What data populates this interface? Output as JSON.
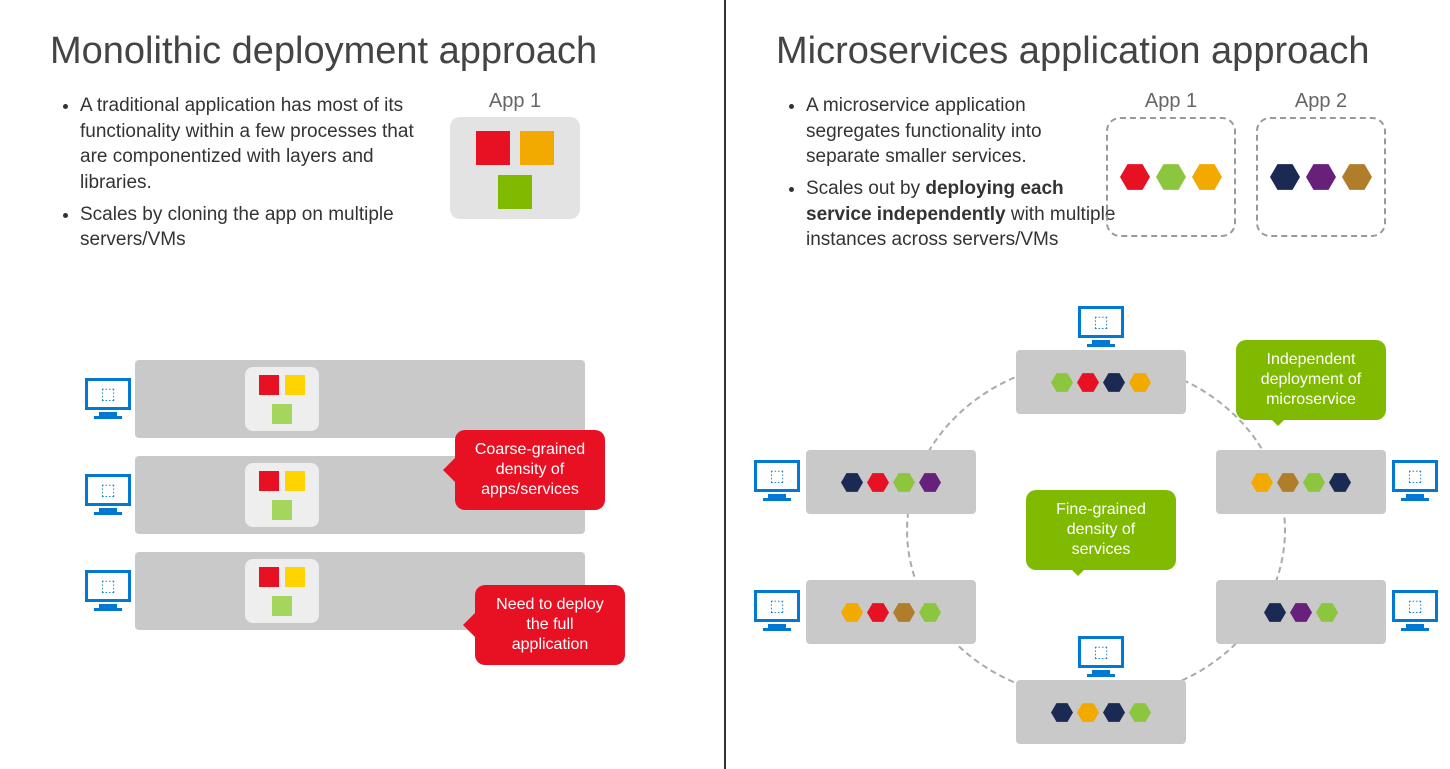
{
  "left": {
    "title": "Monolithic deployment approach",
    "bullets": [
      "A traditional application has most of its functionality within a few processes that are componentized with layers and libraries.",
      "Scales by cloning the app on multiple servers/VMs"
    ],
    "app_label": "App 1",
    "callout1": "Coarse-grained density of apps/services",
    "callout2": "Need to deploy the full application",
    "colors": {
      "red": "#e81123",
      "orange": "#f2a900",
      "green": "#7fba00"
    }
  },
  "right": {
    "title": "Microservices application approach",
    "bullets_pre": "A microservice application segregates functionality into separate smaller services.",
    "bullets_scale_a": "Scales out by ",
    "bullets_scale_bold": "deploying each service independently",
    "bullets_scale_b": " with multiple instances across servers/VMs",
    "app1_label": "App 1",
    "app2_label": "App 2",
    "callout_center": "Fine-grained density of services",
    "callout_right": "Independent deployment of microservice",
    "hex_colors": {
      "red": "#e81123",
      "orange": "#f2a900",
      "green": "#8cc63f",
      "navy": "#1a2a52",
      "purple": "#68217a",
      "brown": "#b07d2b",
      "lgreen": "#a4d65e"
    }
  }
}
